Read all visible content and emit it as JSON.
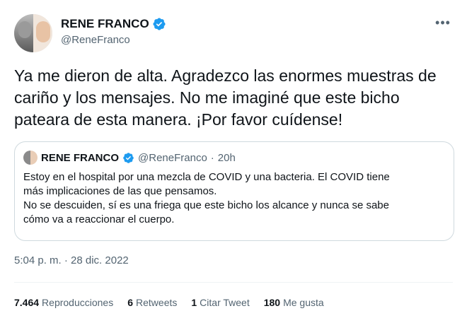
{
  "author": {
    "display_name": "RENE FRANCO",
    "handle": "@ReneFranco"
  },
  "tweet": {
    "text": "Ya me dieron de alta. Agradezco las enormes muestras de cariño y los mensajes. No me imaginé que este bicho pateara de esta manera. ¡Por favor cuídense!",
    "timestamp": "5:04 p. m. · 28 dic. 2022"
  },
  "quote": {
    "display_name": "RENE FRANCO",
    "handle": "@ReneFranco",
    "separator": "·",
    "time_ago": "20h",
    "lines": [
      "Estoy en el hospital por una mezcla de COVID y una bacteria. El COVID tiene",
      "más implicaciones de las que pensamos.",
      "No se descuiden, sí es una friega que este bicho los alcance y nunca se sabe",
      "cómo va a reaccionar el cuerpo."
    ]
  },
  "stats": {
    "views_count": "7.464",
    "views_label": "Reproducciones",
    "retweets_count": "6",
    "retweets_label": "Retweets",
    "quotes_count": "1",
    "quotes_label": "Citar Tweet",
    "likes_count": "180",
    "likes_label": "Me gusta"
  },
  "icons": {
    "verified": "verified-badge-icon",
    "more": "more-options-icon"
  },
  "colors": {
    "verified_blue": "#1d9bf0",
    "secondary_text": "#536471",
    "border": "#cfd9de"
  }
}
